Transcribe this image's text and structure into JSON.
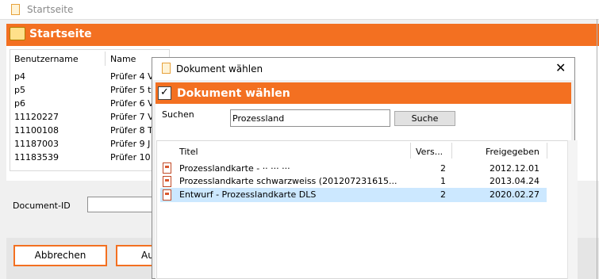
{
  "background_window": {
    "title": "Startseite",
    "header": "Startseite",
    "table": {
      "columns": [
        "Benutzername",
        "Name"
      ],
      "rows": [
        [
          "p4",
          "Prüfer 4 V"
        ],
        [
          "p5",
          "Prüfer 5 t"
        ],
        [
          "p6",
          "Prüfer 6 V"
        ],
        [
          "11120227",
          "Prüfer 7 V"
        ],
        [
          "11100108",
          "Prüfer 8 T"
        ],
        [
          "11187003",
          "Prüfer 9 J"
        ],
        [
          "11183539",
          "Prüfer 10"
        ]
      ]
    },
    "document_id_label": "Document-ID",
    "cancel_label": "Abbrechen",
    "second_button_label": "Au"
  },
  "dialog": {
    "title": "Dokument wählen",
    "header": "Dokument wählen",
    "search_label": "Suchen",
    "search_value": "Prozessland",
    "search_button": "Suche",
    "close_glyph": "✕",
    "check_glyph": "✓",
    "columns": [
      "Titel",
      "Vers...",
      "Freigegeben"
    ],
    "rows": [
      {
        "title": "Prozesslandkarte - ·· ··· ···",
        "version": "2",
        "released": "2012.12.01",
        "selected": false
      },
      {
        "title": "Prozesslandkarte schwarzweiss (201207231615...",
        "version": "1",
        "released": "2013.04.24",
        "selected": false
      },
      {
        "title": "Entwurf - Prozesslandkarte DLS",
        "version": "2",
        "released": "2020.02.27",
        "selected": true
      }
    ]
  },
  "colors": {
    "accent": "#f37021",
    "selection": "#cce8ff"
  },
  "icons": [
    "document-icon",
    "folder-icon",
    "checkbox-icon",
    "close-icon",
    "pdf-icon"
  ]
}
